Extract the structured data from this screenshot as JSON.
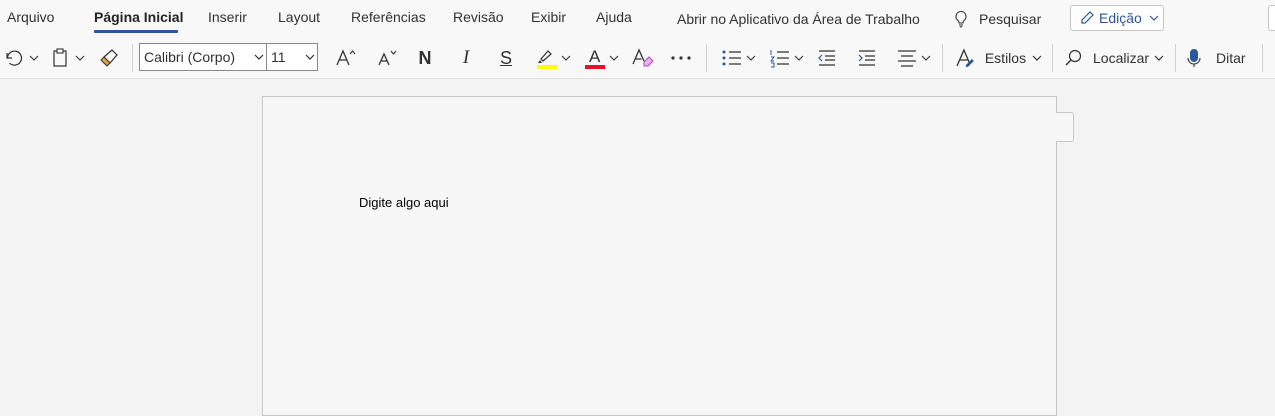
{
  "tabs": [
    {
      "label": "Arquivo"
    },
    {
      "label": "Página Inicial"
    },
    {
      "label": "Inserir"
    },
    {
      "label": "Layout"
    },
    {
      "label": "Referências"
    },
    {
      "label": "Revisão"
    },
    {
      "label": "Exibir"
    },
    {
      "label": "Ajuda"
    }
  ],
  "open_desktop_label": "Abrir no Aplicativo da Área de Trabalho",
  "search": {
    "label": "Pesquisar",
    "icon": "lightbulb-icon"
  },
  "mode": {
    "label": "Edição",
    "icon": "pencil-icon"
  },
  "toolbar": {
    "font_family": "Calibri (Corpo)",
    "font_size": "11",
    "bold_glyph": "N",
    "italic_glyph": "I",
    "strike_glyph": "S",
    "font_color_glyph": "A",
    "styles_label": "Estilos",
    "find_label": "Localizar",
    "dictate_label": "Ditar",
    "highlight_color": "#ffff00",
    "font_color": "#e81123"
  },
  "document": {
    "body_text": "Digite algo aqui"
  },
  "colors": {
    "accent": "#2b579a"
  }
}
